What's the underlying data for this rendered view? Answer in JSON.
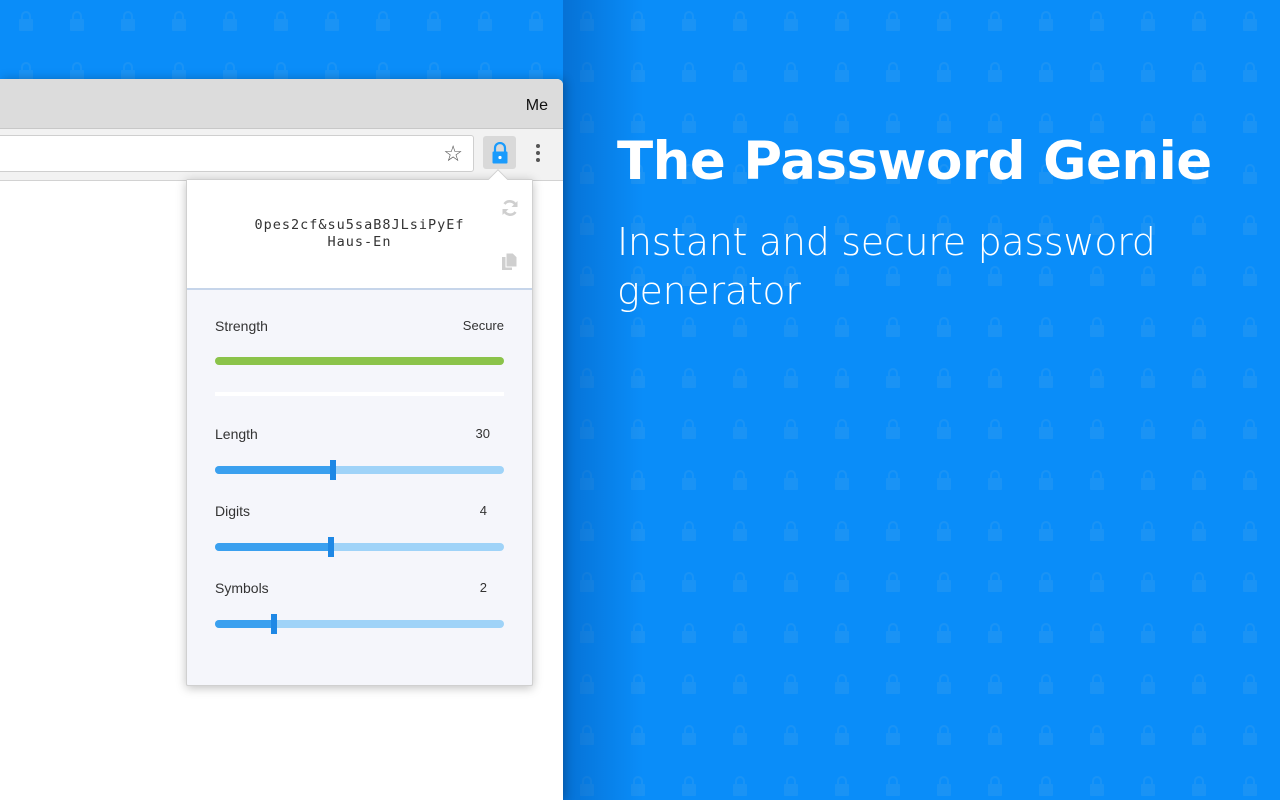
{
  "browser": {
    "profile_label": "Me",
    "bookmark_icon": "star-icon",
    "extension_icon": "lock-icon",
    "menu_icon": "vertical-ellipsis-icon"
  },
  "popup": {
    "password_line1": "0pes2cf&su5saB8JLsiPyEf",
    "password_line2": "Haus-En",
    "refresh_icon": "refresh-icon",
    "copy_icon": "copy-icon",
    "strength": {
      "label": "Strength",
      "value": "Secure",
      "level": 1.0,
      "color": "#8bc34a"
    },
    "sliders": [
      {
        "label": "Length",
        "value": "30",
        "fraction": 0.41
      },
      {
        "label": "Digits",
        "value": "4",
        "fraction": 0.4
      },
      {
        "label": "Symbols",
        "value": "2",
        "fraction": 0.205
      }
    ]
  },
  "hero": {
    "title": "The Password Genie",
    "subtitle": "Instant and secure password generator"
  },
  "colors": {
    "background": "#0a8df9",
    "accent": "#1e88e5",
    "slider_fill": "#3aa0ef",
    "slider_track": "#9fd3f8",
    "strength": "#8bc34a"
  }
}
